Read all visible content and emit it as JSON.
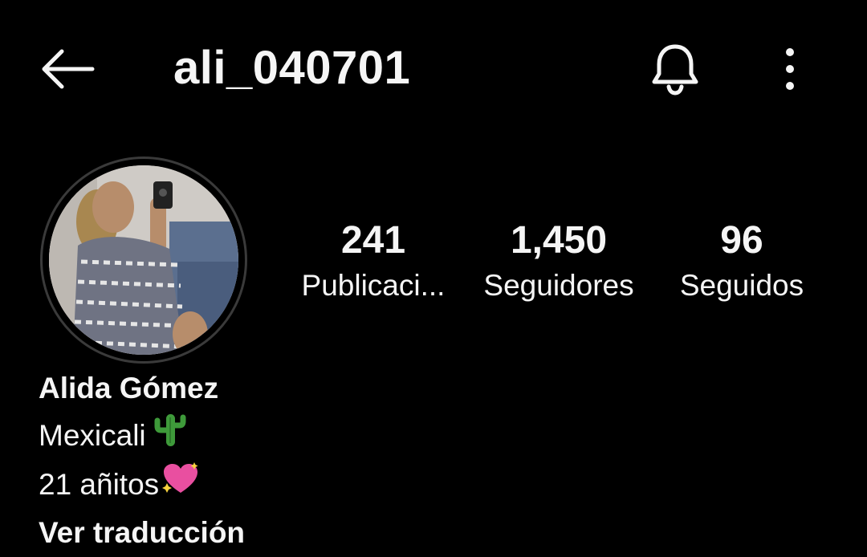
{
  "header": {
    "username": "ali_040701",
    "back_icon": "arrow-left-icon",
    "bell_icon": "bell-icon",
    "more_icon": "more-vertical-icon"
  },
  "profile": {
    "avatar_icon": "profile-photo",
    "stats": [
      {
        "count": "241",
        "label": "Publicaci..."
      },
      {
        "count": "1,450",
        "label": "Seguidores"
      },
      {
        "count": "96",
        "label": "Seguidos"
      }
    ]
  },
  "bio": {
    "name": "Alida Gómez",
    "line1": "Mexicali",
    "line1_emoji": "cactus-icon",
    "line2": "21 añitos",
    "line2_emoji": "sparkling-heart-icon",
    "translate_label": "Ver traducción"
  },
  "colors": {
    "background": "#000000",
    "text": "#f5f5f5",
    "avatar_ring": "#3a3a3a"
  }
}
